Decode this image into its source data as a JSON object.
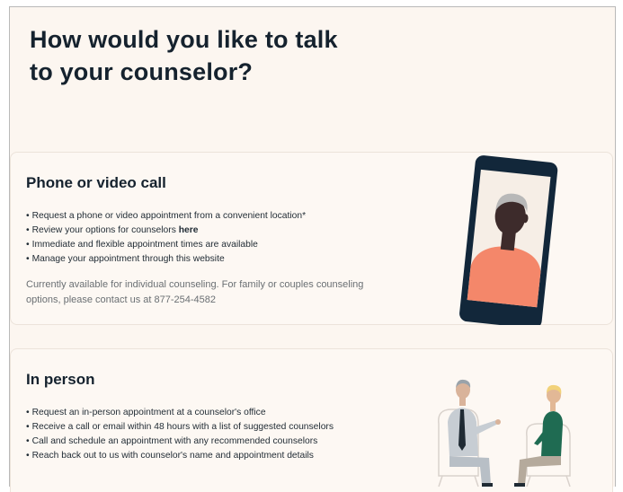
{
  "page": {
    "title": "How would you like to talk to your counselor?"
  },
  "phone_option": {
    "title": "Phone or video call",
    "bullets": [
      {
        "text": "Request a phone or video appointment from a convenient location*",
        "link": ""
      },
      {
        "text": "Review your options for counselors ",
        "link": "here"
      },
      {
        "text": "Immediate and flexible appointment times are available",
        "link": ""
      },
      {
        "text": "Manage your appointment through this website",
        "link": ""
      }
    ],
    "note": "Currently available for individual counseling. For family or couples counseling options, please contact us at 877-254-4582"
  },
  "in_person_option": {
    "title": "In person",
    "bullets": [
      {
        "text": "Request an in-person appointment at a counselor's office"
      },
      {
        "text": "Receive a call or email within 48 hours with a list of suggested counselors"
      },
      {
        "text": "Call and schedule an appointment with any recommended counselors"
      },
      {
        "text": "Reach back out to us with counselor's name and appointment details"
      }
    ]
  },
  "colors": {
    "background": "#fcf6f0",
    "card": "#fdf8f3",
    "heading": "#15222e",
    "phone_body": "#12273a",
    "person_shirt": "#f4876a",
    "counselor_suit": "#c7cdd3",
    "client_shirt": "#1f6b52"
  },
  "icons": {
    "phone_illustration": "video-call-phone-illustration",
    "in_person_illustration": "counseling-session-illustration"
  }
}
